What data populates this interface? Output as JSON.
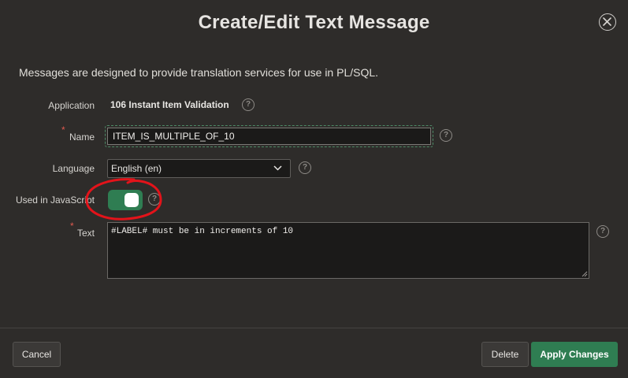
{
  "dialog": {
    "title": "Create/Edit Text Message",
    "close_icon": "close-icon"
  },
  "intro": "Messages are designed to provide translation services for use in PL/SQL.",
  "form": {
    "application": {
      "label": "Application",
      "value": "106 Instant Item Validation"
    },
    "name": {
      "label": "Name",
      "required_mark": "*",
      "value": "ITEM_IS_MULTIPLE_OF_10"
    },
    "language": {
      "label": "Language",
      "value": "English (en)"
    },
    "used_in_javascript": {
      "label": "Used in JavaScript",
      "checked": true
    },
    "text": {
      "label": "Text",
      "required_mark": "*",
      "value": "#LABEL# must be in increments of 10"
    },
    "help_icon_glyph": "?"
  },
  "footer": {
    "cancel_label": "Cancel",
    "delete_label": "Delete",
    "apply_label": "Apply Changes"
  },
  "colors": {
    "background": "#2e2c2a",
    "accent_green": "#2f7d52",
    "required_red": "#e05a4f",
    "annotation_red": "#e3131a"
  }
}
